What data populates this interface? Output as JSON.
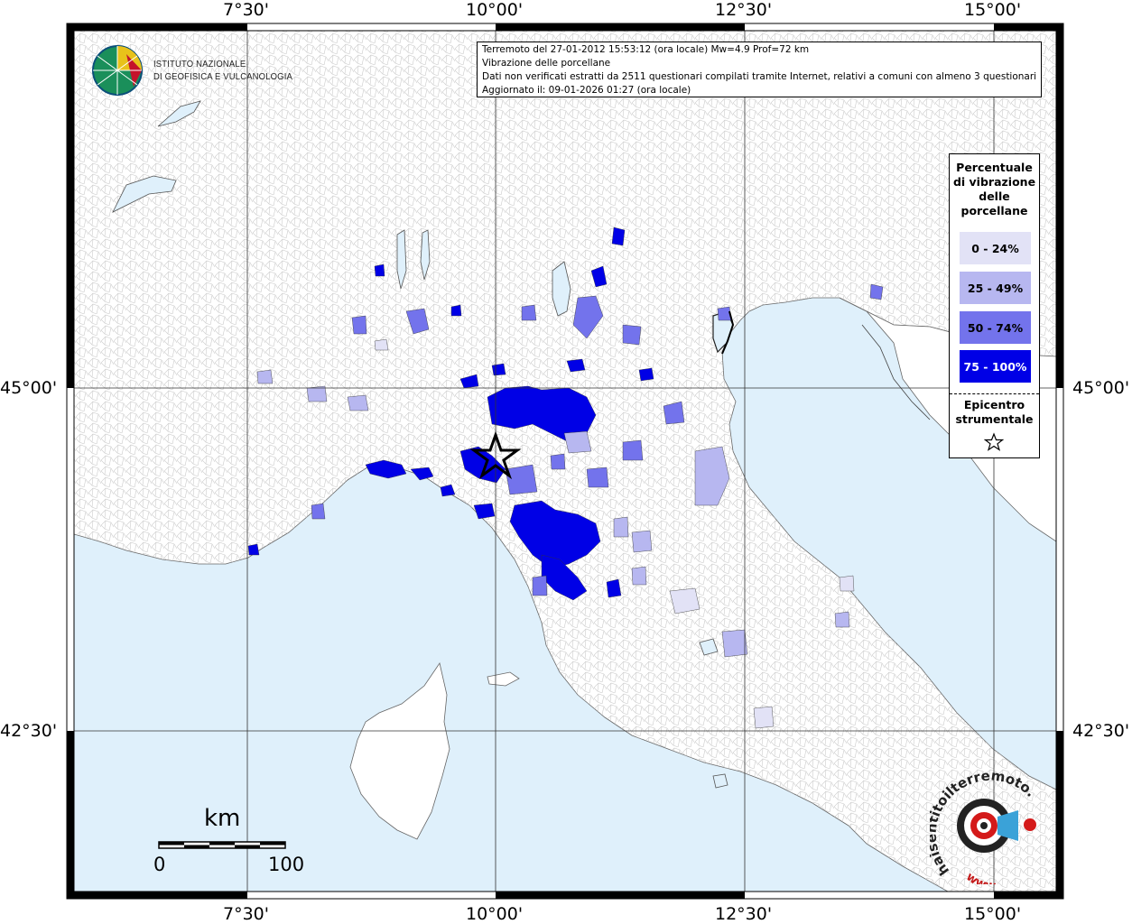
{
  "axes": {
    "top_labels": [
      "7°30'",
      "10°00'",
      "12°30'",
      "15°00'"
    ],
    "bottom_labels": [
      "7°30'",
      "10°00'",
      "12°30'",
      "15°00'"
    ],
    "left_labels": [
      "45°00'",
      "42°30'"
    ],
    "right_labels": [
      "45°00'",
      "42°30'"
    ]
  },
  "info": {
    "line1": "Terremoto del 27-01-2012 15:53:12 (ora locale) Mw=4.9 Prof=72 km",
    "line2": "Vibrazione delle porcellane",
    "line3": "Dati non verificati estratti da 2511 questionari compilati tramite Internet, relativi a comuni con almeno 3 questionari.",
    "line4": "Aggiornato il: 09-01-2026 01:27 (ora locale)"
  },
  "ingv": {
    "line1": "ISTITUTO NAZIONALE",
    "line2": "DI GEOFISICA E VULCANOLOGIA"
  },
  "legend": {
    "title_lines": [
      "Percentuale",
      "di vibrazione",
      "delle",
      "porcellane"
    ],
    "classes": [
      {
        "label": "0 - 24%",
        "color": "#e2e2f6",
        "text_color": "#000000"
      },
      {
        "label": "25 - 49%",
        "color": "#b7b7f0",
        "text_color": "#000000"
      },
      {
        "label": "50 - 74%",
        "color": "#7373ec",
        "text_color": "#000000"
      },
      {
        "label": "75 - 100%",
        "color": "#0000e6",
        "text_color": "#ffffff"
      }
    ],
    "epicenter_lines": [
      "Epicentro",
      "strumentale"
    ]
  },
  "scale": {
    "unit": "km",
    "min_label": "0",
    "max_label": "100"
  },
  "logo": {
    "brand": "haisentitoilterremoto.it",
    "url_text": "www."
  },
  "colors": {
    "sea": "#dff0fb",
    "land": "#ffffff"
  }
}
